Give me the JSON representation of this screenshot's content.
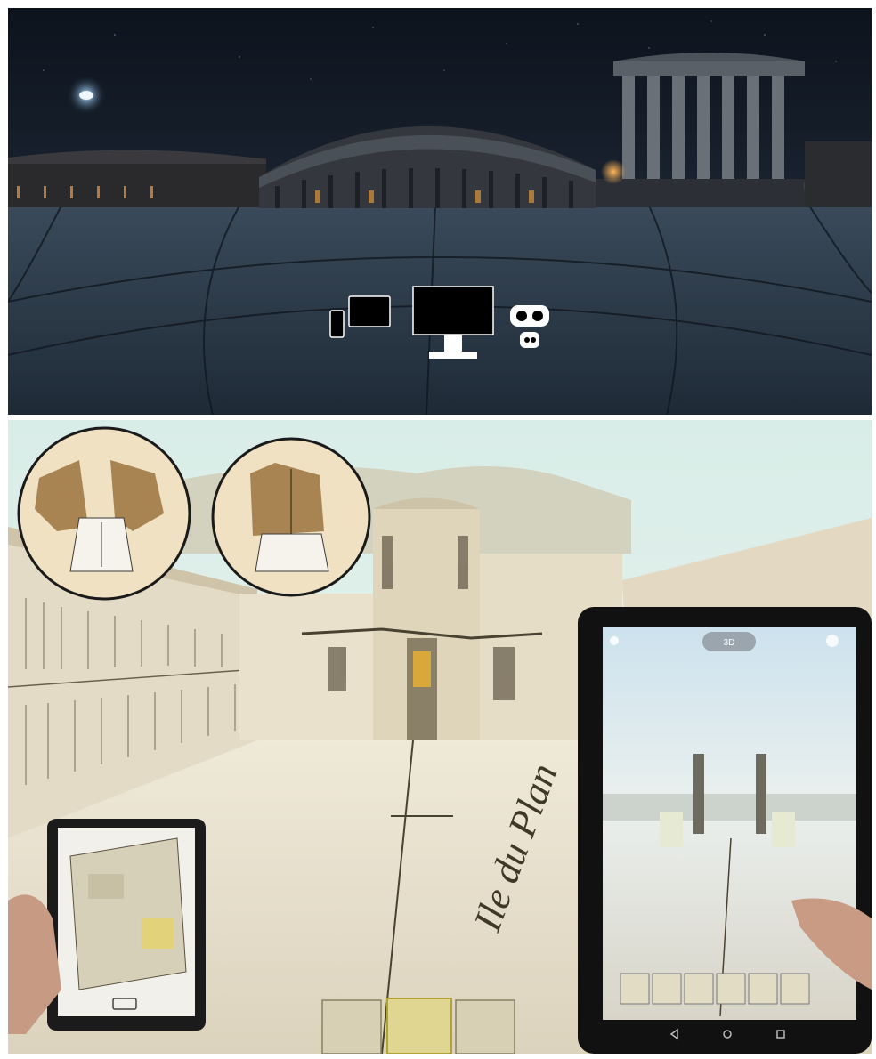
{
  "top_scene": {
    "devices": [
      {
        "name": "phone-icon"
      },
      {
        "name": "tablet-icon"
      },
      {
        "name": "desktop-monitor-icon"
      },
      {
        "name": "vr-headset-icon"
      },
      {
        "name": "cardboard-viewer-icon"
      }
    ],
    "colors": {
      "sky": "#141c28",
      "floor": "#2b3a4a",
      "moon": "#cfe2f3",
      "lamp": "#e8a24a"
    }
  },
  "bottom_scene": {
    "floor_caption": "Ile du Plan",
    "left_tablet": {
      "footer_icon": "book-icon"
    },
    "right_tablet": {
      "top_badge": "3D",
      "thumbnails": 6
    },
    "colors": {
      "sky": "#dff0ea",
      "stone": "#e6dcc6",
      "floor": "#e9e2cf"
    }
  }
}
